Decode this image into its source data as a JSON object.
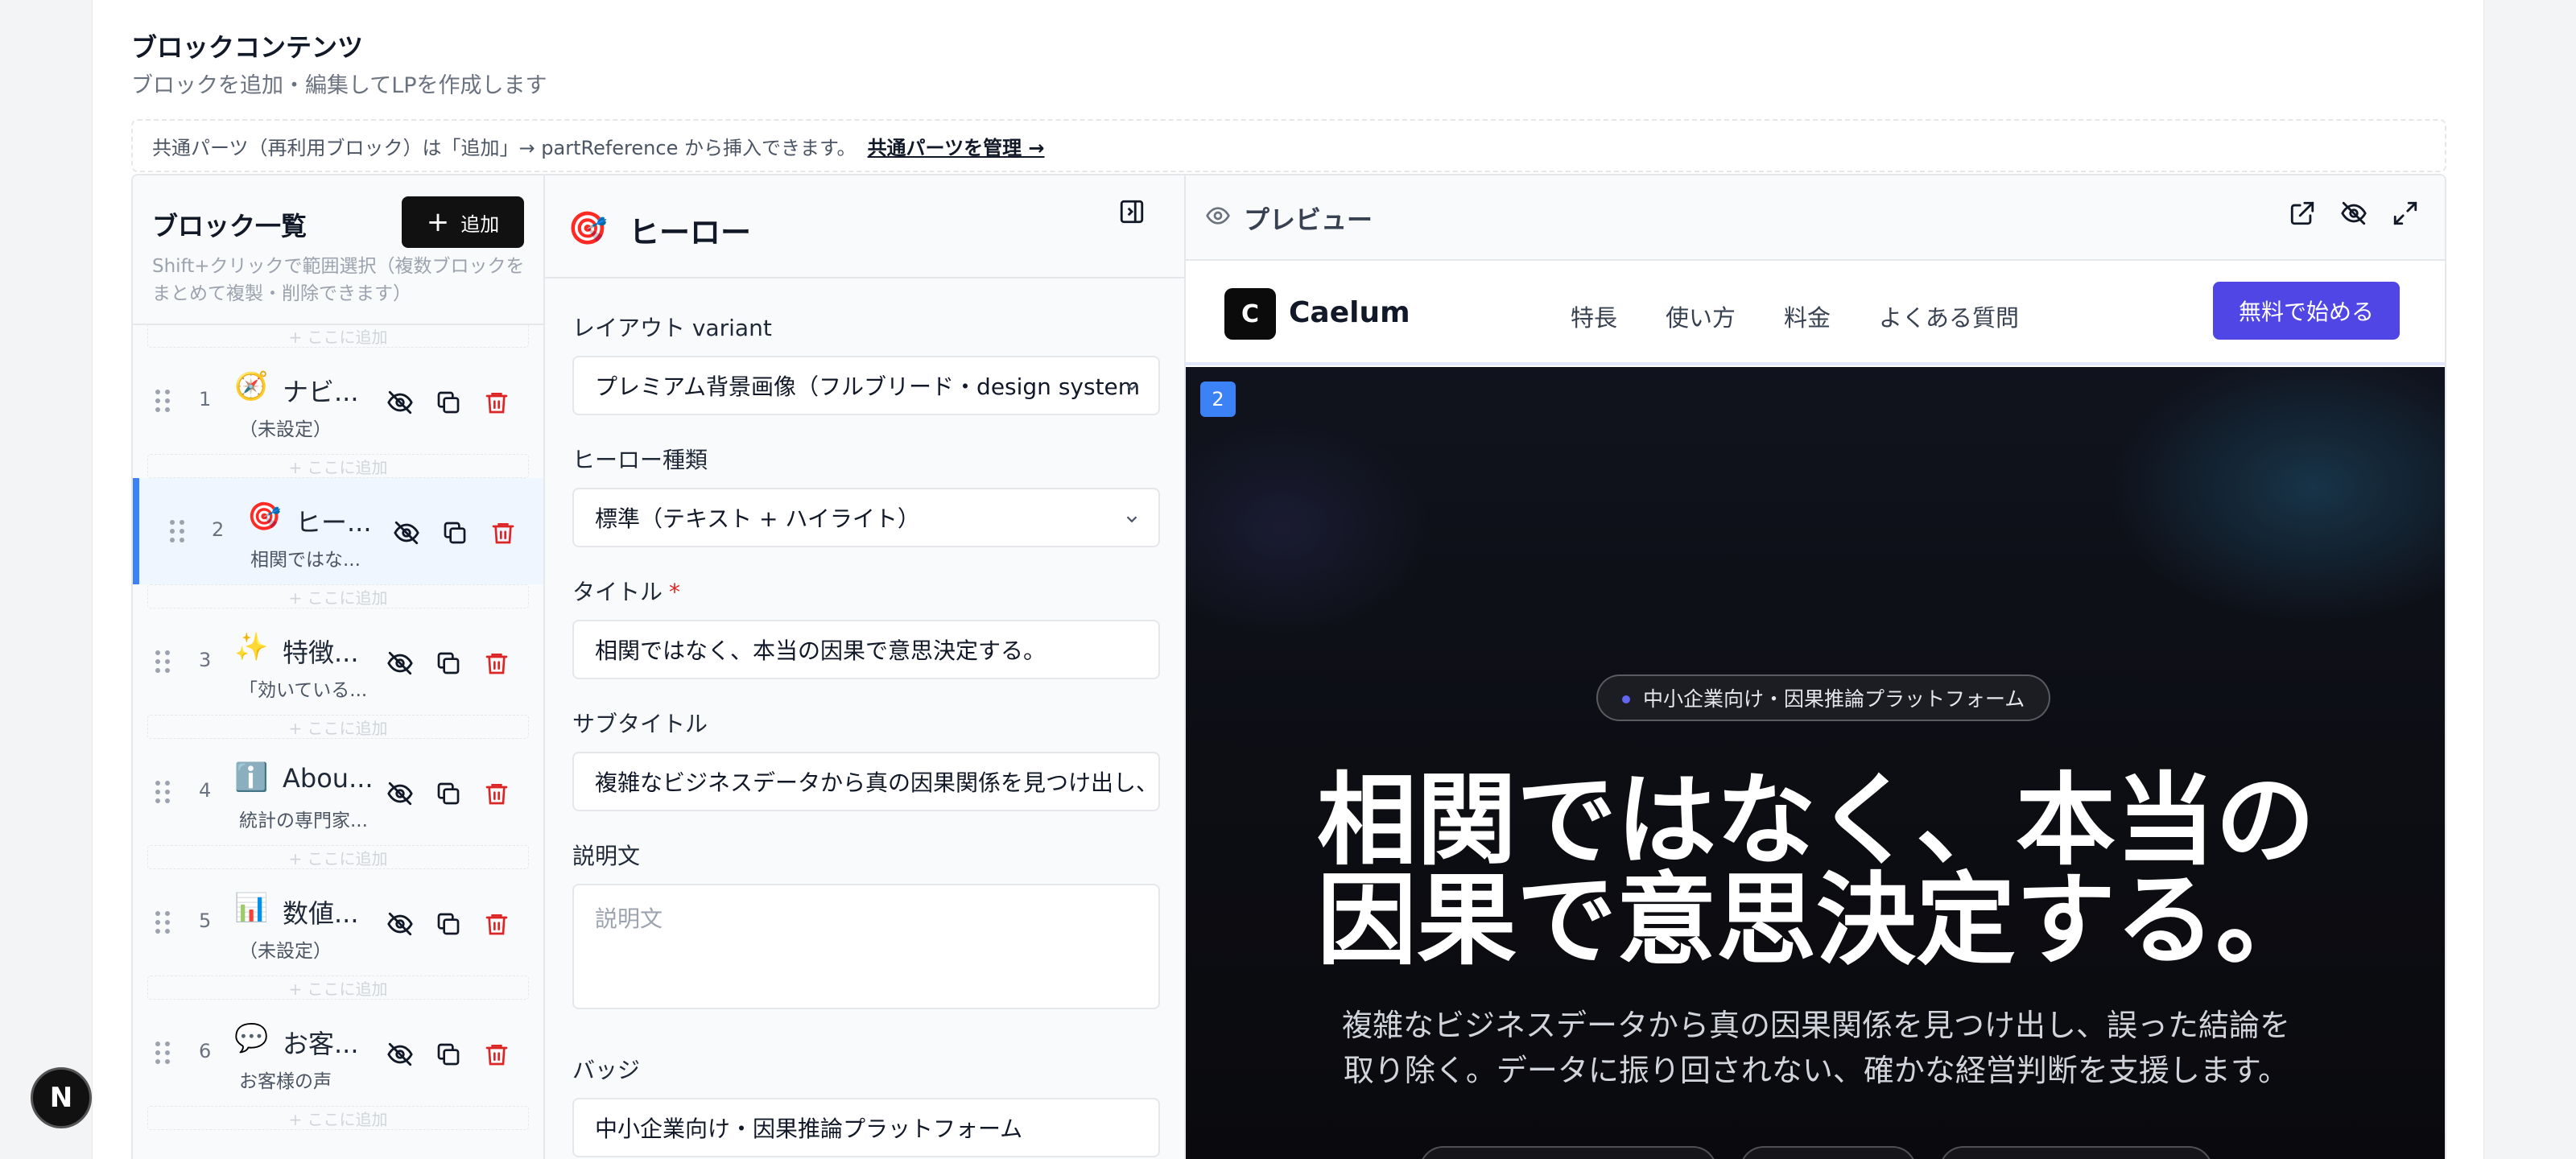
{
  "page": {
    "title": "ブロックコンテンツ",
    "subtitle": "ブロックを追加・編集してLPを作成します",
    "notice": "共通パーツ（再利用ブロック）は「追加」→ partReference から挿入できます。",
    "notice_link": "共通パーツを管理 →"
  },
  "block_list": {
    "title": "ブロック一覧",
    "add_label": "追加",
    "hint": "Shift+クリックで範囲選択（複数ブロックをまとめて複製・削除できます）",
    "slot_label": "+ ここに追加",
    "items": [
      {
        "num": "1",
        "emoji": "🧭",
        "name": "ナビ...",
        "desc": "（未設定）",
        "selected": false
      },
      {
        "num": "2",
        "emoji": "🎯",
        "name": "ヒー...",
        "desc": "相関ではな...",
        "selected": true
      },
      {
        "num": "3",
        "emoji": "✨",
        "name": "特徴...",
        "desc": "「効いている...",
        "selected": false
      },
      {
        "num": "4",
        "emoji": "ℹ️",
        "name": "Abou...",
        "desc": "統計の専門家...",
        "selected": false
      },
      {
        "num": "5",
        "emoji": "📊",
        "name": "数値...",
        "desc": "（未設定）",
        "selected": false
      },
      {
        "num": "6",
        "emoji": "💬",
        "name": "お客...",
        "desc": "お客様の声",
        "selected": false
      }
    ]
  },
  "editor": {
    "emoji": "🎯",
    "title": "ヒーロー",
    "layout_label": "レイアウト variant",
    "layout_value": "プレミアム背景画像（フルブリード・design system",
    "hero_type_label": "ヒーロー種類",
    "hero_type_value": "標準（テキスト + ハイライト）",
    "title_label": "タイトル",
    "required_mark": "*",
    "title_value": "相関ではなく、本当の因果で意思決定する。",
    "subtitle_label": "サブタイトル",
    "subtitle_value": "複雑なビジネスデータから真の因果関係を見つけ出し、",
    "description_label": "説明文",
    "description_placeholder": "説明文",
    "badge_label": "バッジ",
    "badge_value": "中小企業向け・因果推論プラットフォーム"
  },
  "preview": {
    "title": "プレビュー",
    "site": {
      "logo_letter": "C",
      "logo_text": "Caelum",
      "nav": [
        "特長",
        "使い方",
        "料金",
        "よくある質問"
      ],
      "cta": "無料で始める"
    },
    "block_number": "2",
    "hero": {
      "badge": "中小企業向け・因果推論プラットフォーム",
      "title_line1": "相関ではなく、本当の",
      "title_line2": "因果で意思決定する。",
      "sub_line1": "複雑なビジネスデータから真の因果関係を見つけ出し、誤った結論を",
      "sub_line2": "取り除く。データに振り回されない、確かな経営判断を支援します。"
    }
  },
  "fab": {
    "letter": "N"
  },
  "colors": {
    "accent": "#4f46e5",
    "selected": "#3b82f6",
    "danger": "#dc2626"
  }
}
